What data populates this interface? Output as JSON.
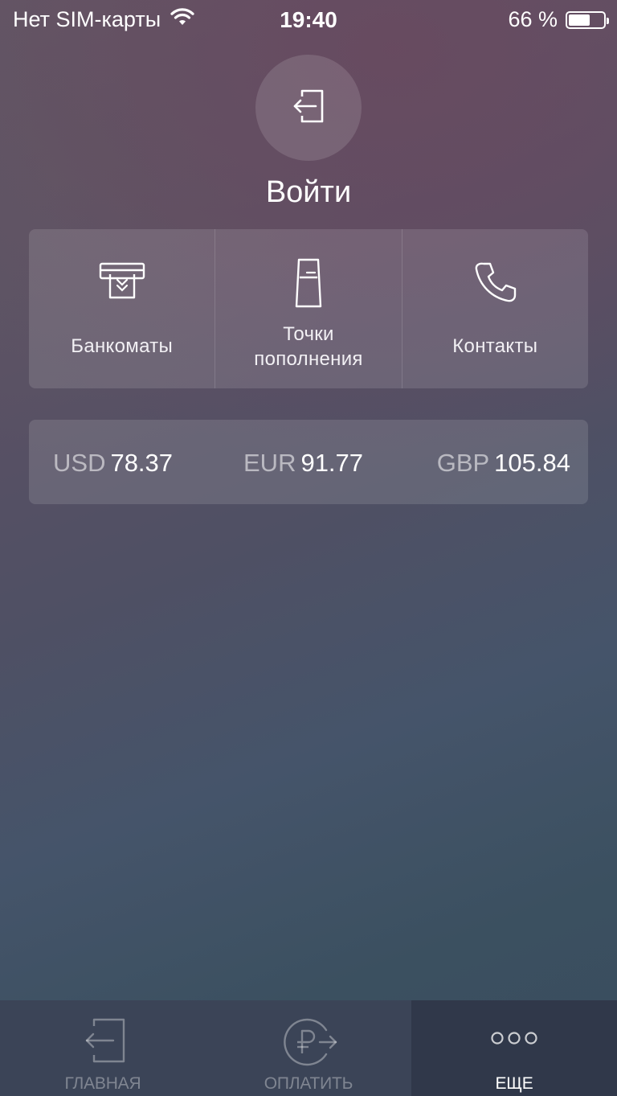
{
  "status_bar": {
    "carrier": "Нет SIM-карты",
    "time": "19:40",
    "battery": "66 %",
    "battery_level": 0.66
  },
  "login": {
    "label": "Войти",
    "icon": "login-icon"
  },
  "quick_links": [
    {
      "label": "Банкоматы",
      "icon": "atm-icon"
    },
    {
      "label_line1": "Точки",
      "label_line2": "пополнения",
      "icon": "terminal-icon"
    },
    {
      "label": "Контакты",
      "icon": "phone-icon"
    }
  ],
  "currency_rates": [
    {
      "code": "USD",
      "value": "78.37"
    },
    {
      "code": "EUR",
      "value": "91.77"
    },
    {
      "code": "GBP",
      "value": "105.84"
    }
  ],
  "tab_bar": {
    "tabs": [
      {
        "label": "ГЛАВНАЯ",
        "icon": "login-icon",
        "active": false
      },
      {
        "label": "ОПЛАТИТЬ",
        "icon": "ruble-transfer-icon",
        "active": false
      },
      {
        "label": "ЕЩЕ",
        "icon": "more-dots-icon",
        "active": true
      }
    ]
  },
  "colors": {
    "tab_bar_bg": "#3b4457",
    "tab_active_bg": "#30384a"
  }
}
